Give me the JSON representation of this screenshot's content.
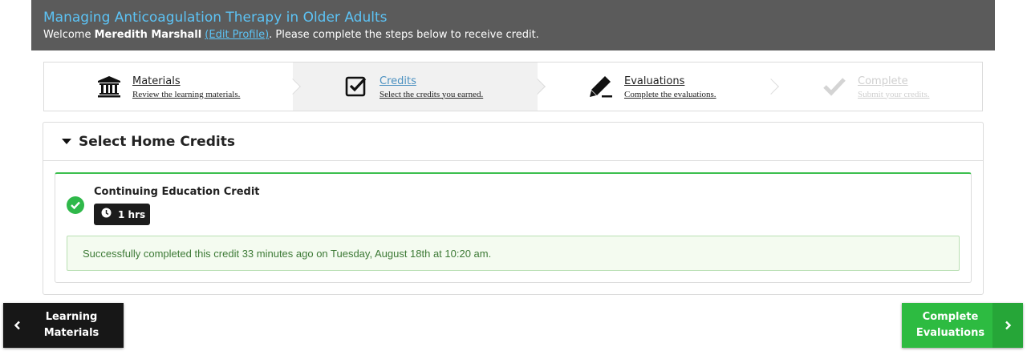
{
  "header": {
    "title": "Managing Anticoagulation Therapy in Older Adults",
    "welcome_prefix": "Welcome ",
    "user_name": "Meredith Marshall",
    "edit_profile": "(Edit Profile)",
    "welcome_suffix": ". Please complete the steps below to receive credit."
  },
  "steps": [
    {
      "title": "Materials",
      "subtitle": "Review the learning materials.",
      "icon": "bank-icon",
      "state": "default"
    },
    {
      "title": "Credits",
      "subtitle": "Select the credits you earned.",
      "icon": "checkbox-icon",
      "state": "active"
    },
    {
      "title": "Evaluations",
      "subtitle": "Complete the evaluations.",
      "icon": "pencil-icon",
      "state": "default"
    },
    {
      "title": "Complete",
      "subtitle": "Submit your credits.",
      "icon": "checkmark-icon",
      "state": "disabled"
    }
  ],
  "panel": {
    "title": "Select Home Credits",
    "credit": {
      "name": "Continuing Education Credit",
      "hours": "1 hrs",
      "status_message": "Successfully completed this credit 33 minutes ago on Tuesday, August 18th at 10:20 am."
    }
  },
  "nav": {
    "prev_line1": "Learning",
    "prev_line2": "Materials",
    "next_line1": "Complete",
    "next_line2": "Evaluations"
  },
  "colors": {
    "header_bg": "#5b5b5b",
    "title_blue": "#5cc3f5",
    "success_green": "#2dbb41"
  }
}
